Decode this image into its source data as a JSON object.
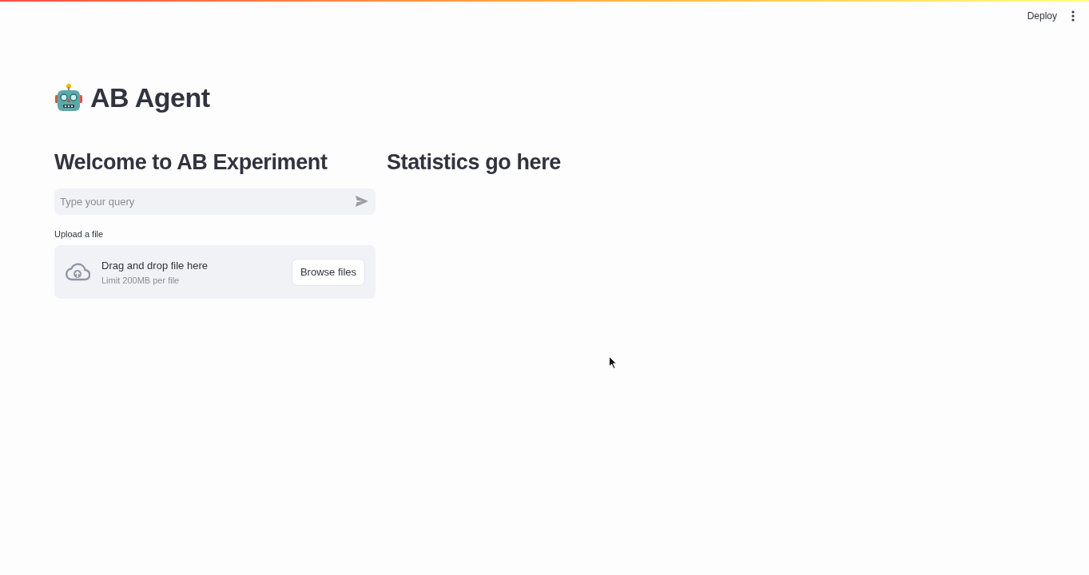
{
  "header": {
    "deploy_button": "Deploy"
  },
  "title": "AB Agent",
  "columns": [
    {
      "heading": "Welcome to AB Experiment",
      "chat_input": {
        "placeholder": "Type your query"
      },
      "file_uploader": {
        "label": "Upload a file",
        "dropzone_text": "Drag and drop file here",
        "limit_text": "Limit 200MB per file",
        "button": "Browse files"
      }
    },
    {
      "heading": "Statistics go here"
    }
  ]
}
